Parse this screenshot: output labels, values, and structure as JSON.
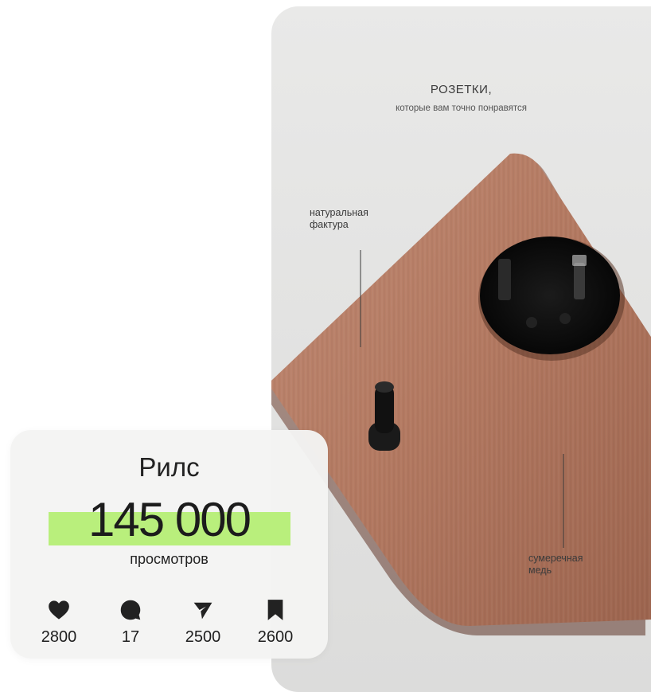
{
  "photo": {
    "title": "РОЗЕТКИ,",
    "subtitle": "которые вам точно понравятся",
    "callout_texture": "натуральная\nфактура",
    "callout_color": "сумеречная\nмедь"
  },
  "card": {
    "title": "Рилс",
    "views_number": "145 000",
    "views_label": "просмотров",
    "highlight_color": "#b3ee6f",
    "stats": [
      {
        "icon": "heart-icon",
        "value": "2800"
      },
      {
        "icon": "comment-icon",
        "value": "17"
      },
      {
        "icon": "send-icon",
        "value": "2500"
      },
      {
        "icon": "bookmark-icon",
        "value": "2600"
      }
    ]
  }
}
